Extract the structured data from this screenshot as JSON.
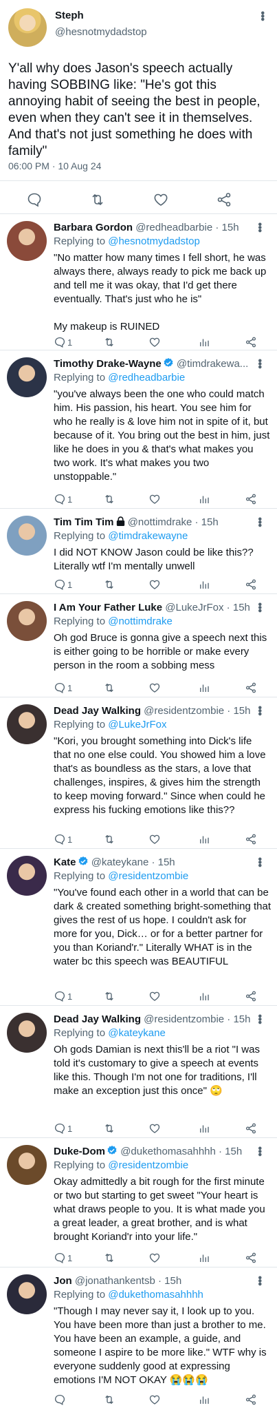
{
  "main": {
    "name": "Steph",
    "handle": "@hesnotmydadstop",
    "text": "Y'all why does Jason's speech actually having SOBBING like:  \"He's got this annoying habit of seeing the best in people, even when they can't see it in themselves. And that's not just something he does with family\"",
    "timestamp": "06:00 PM · 10 Aug 24",
    "actions": [
      "comment-icon",
      "retweet-icon",
      "like-icon",
      "share-icon"
    ]
  },
  "replies": [
    {
      "name": "Barbara Gordon",
      "handle": "@redheadbarbie · 15h",
      "replying_label": "Replying to",
      "replying_to": "@hesnotmydadstop",
      "text": "\"No matter how many times I fell short, he was always there, always ready to pick me back up and tell me it was okay, that I'd get there eventually. That's just who he is\"\n\nMy makeup is RUINED",
      "reply_count": "1",
      "avatar_color": "#8a4a3a"
    },
    {
      "name": "Timothy Drake-Wayne",
      "verified": true,
      "handle": "@timdrakewa...",
      "replying_label": "Replying to",
      "replying_to": "@redheadbarbie",
      "text": "\"you've always been the one who could match him. His passion, his heart. You see him for who he really is & love him not in spite of it, but because of it. You bring out the best in him, just like he does in you & that's what makes you two work. It's what makes you two unstoppable.\"",
      "reply_count": "1",
      "avatar_color": "#2b3347"
    },
    {
      "name": "Tim Tim Tim",
      "locked": true,
      "handle": "@nottimdrake · 15h",
      "replying_label": "Replying to",
      "replying_to": "@timdrakewayne",
      "text": "I did NOT KNOW Jason could be like this?? Literally wtf I'm mentally unwell",
      "reply_count": "1",
      "avatar_color": "#7fa0c0"
    },
    {
      "name": "I Am Your Father Luke",
      "handle": "@LukeJrFox · 15h",
      "replying_label": "Replying to",
      "replying_to": "@nottimdrake",
      "text": "Oh god Bruce is gonna give a speech next this is either going to be horrible or make every person in the room a sobbing mess",
      "reply_count": "1",
      "avatar_color": "#7a4f3a"
    },
    {
      "name": "Dead Jay Walking",
      "handle": "@residentzombie · 15h",
      "replying_label": "Replying to",
      "replying_to": "@LukeJrFox",
      "text": "\"Kori, you brought something into Dick's life that no one else could. You showed him a love that's as boundless as the stars, a love that challenges, inspires, & gives him the strength to keep moving forward.\" Since when could he express his fucking emotions like this??",
      "reply_count": "1",
      "avatar_color": "#3a3030"
    },
    {
      "name": "Kate",
      "verified": true,
      "handle": "@kateykane · 15h",
      "replying_label": "Replying to",
      "replying_to": "@residentzombie",
      "text": "\"You've found each other in a world that can be dark & created something bright-something that gives the rest of us hope. I couldn't ask for more for you, Dick… or for a better partner for you than Koriand'r.\" Literally WHAT is in the water bc this speech was BEAUTIFUL",
      "reply_count": "1",
      "avatar_color": "#3a2a4a"
    },
    {
      "name": "Dead Jay Walking",
      "handle": "@residentzombie · 15h",
      "replying_label": "Replying to",
      "replying_to": "@kateykane",
      "text": "Oh gods Damian is next this'll be a riot  \"I was told it's customary to give a speech at events like this. Though I'm not one for traditions, I'll make an exception just this once\" 🙄",
      "reply_count": "1",
      "avatar_color": "#3a3030"
    },
    {
      "name": "Duke-Dom",
      "verified": true,
      "handle": "@dukethomasahhhh · 15h",
      "replying_label": "Replying to",
      "replying_to": "@residentzombie",
      "text": "Okay admittedly a bit rough for the first minute or two but starting to get sweet \"Your heart is what draws people to you. It is what made you a great leader, a great brother, and is what brought Koriand'r into your life.\"",
      "reply_count": "1",
      "avatar_color": "#6b4a2a"
    },
    {
      "name": "Jon",
      "handle": "@jonathankentsb · 15h",
      "replying_label": "Replying to",
      "replying_to": "@dukethomasahhhh",
      "text": "\"Though I may never say it, I look up to you. You have been more than just a brother to me. You have been an example, a guide, and someone I aspire to be more like.\" WTF why is everyone suddenly good at expressing emotions I'M NOT OKAY 😭😭😭",
      "reply_count": "",
      "avatar_color": "#2a2a3a"
    }
  ]
}
